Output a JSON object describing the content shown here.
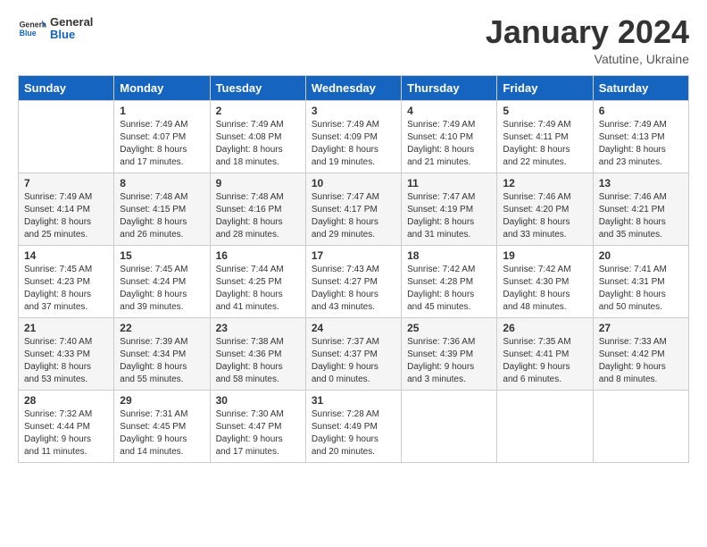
{
  "header": {
    "logo_general": "General",
    "logo_blue": "Blue",
    "month_title": "January 2024",
    "location": "Vatutine, Ukraine"
  },
  "days_of_week": [
    "Sunday",
    "Monday",
    "Tuesday",
    "Wednesday",
    "Thursday",
    "Friday",
    "Saturday"
  ],
  "weeks": [
    [
      {
        "day": "",
        "sunrise": "",
        "sunset": "",
        "daylight": ""
      },
      {
        "day": "1",
        "sunrise": "7:49 AM",
        "sunset": "4:07 PM",
        "daylight": "8 hours and 17 minutes."
      },
      {
        "day": "2",
        "sunrise": "7:49 AM",
        "sunset": "4:08 PM",
        "daylight": "8 hours and 18 minutes."
      },
      {
        "day": "3",
        "sunrise": "7:49 AM",
        "sunset": "4:09 PM",
        "daylight": "8 hours and 19 minutes."
      },
      {
        "day": "4",
        "sunrise": "7:49 AM",
        "sunset": "4:10 PM",
        "daylight": "8 hours and 21 minutes."
      },
      {
        "day": "5",
        "sunrise": "7:49 AM",
        "sunset": "4:11 PM",
        "daylight": "8 hours and 22 minutes."
      },
      {
        "day": "6",
        "sunrise": "7:49 AM",
        "sunset": "4:13 PM",
        "daylight": "8 hours and 23 minutes."
      }
    ],
    [
      {
        "day": "7",
        "sunrise": "7:49 AM",
        "sunset": "4:14 PM",
        "daylight": "8 hours and 25 minutes."
      },
      {
        "day": "8",
        "sunrise": "7:48 AM",
        "sunset": "4:15 PM",
        "daylight": "8 hours and 26 minutes."
      },
      {
        "day": "9",
        "sunrise": "7:48 AM",
        "sunset": "4:16 PM",
        "daylight": "8 hours and 28 minutes."
      },
      {
        "day": "10",
        "sunrise": "7:47 AM",
        "sunset": "4:17 PM",
        "daylight": "8 hours and 29 minutes."
      },
      {
        "day": "11",
        "sunrise": "7:47 AM",
        "sunset": "4:19 PM",
        "daylight": "8 hours and 31 minutes."
      },
      {
        "day": "12",
        "sunrise": "7:46 AM",
        "sunset": "4:20 PM",
        "daylight": "8 hours and 33 minutes."
      },
      {
        "day": "13",
        "sunrise": "7:46 AM",
        "sunset": "4:21 PM",
        "daylight": "8 hours and 35 minutes."
      }
    ],
    [
      {
        "day": "14",
        "sunrise": "7:45 AM",
        "sunset": "4:23 PM",
        "daylight": "8 hours and 37 minutes."
      },
      {
        "day": "15",
        "sunrise": "7:45 AM",
        "sunset": "4:24 PM",
        "daylight": "8 hours and 39 minutes."
      },
      {
        "day": "16",
        "sunrise": "7:44 AM",
        "sunset": "4:25 PM",
        "daylight": "8 hours and 41 minutes."
      },
      {
        "day": "17",
        "sunrise": "7:43 AM",
        "sunset": "4:27 PM",
        "daylight": "8 hours and 43 minutes."
      },
      {
        "day": "18",
        "sunrise": "7:42 AM",
        "sunset": "4:28 PM",
        "daylight": "8 hours and 45 minutes."
      },
      {
        "day": "19",
        "sunrise": "7:42 AM",
        "sunset": "4:30 PM",
        "daylight": "8 hours and 48 minutes."
      },
      {
        "day": "20",
        "sunrise": "7:41 AM",
        "sunset": "4:31 PM",
        "daylight": "8 hours and 50 minutes."
      }
    ],
    [
      {
        "day": "21",
        "sunrise": "7:40 AM",
        "sunset": "4:33 PM",
        "daylight": "8 hours and 53 minutes."
      },
      {
        "day": "22",
        "sunrise": "7:39 AM",
        "sunset": "4:34 PM",
        "daylight": "8 hours and 55 minutes."
      },
      {
        "day": "23",
        "sunrise": "7:38 AM",
        "sunset": "4:36 PM",
        "daylight": "8 hours and 58 minutes."
      },
      {
        "day": "24",
        "sunrise": "7:37 AM",
        "sunset": "4:37 PM",
        "daylight": "9 hours and 0 minutes."
      },
      {
        "day": "25",
        "sunrise": "7:36 AM",
        "sunset": "4:39 PM",
        "daylight": "9 hours and 3 minutes."
      },
      {
        "day": "26",
        "sunrise": "7:35 AM",
        "sunset": "4:41 PM",
        "daylight": "9 hours and 6 minutes."
      },
      {
        "day": "27",
        "sunrise": "7:33 AM",
        "sunset": "4:42 PM",
        "daylight": "9 hours and 8 minutes."
      }
    ],
    [
      {
        "day": "28",
        "sunrise": "7:32 AM",
        "sunset": "4:44 PM",
        "daylight": "9 hours and 11 minutes."
      },
      {
        "day": "29",
        "sunrise": "7:31 AM",
        "sunset": "4:45 PM",
        "daylight": "9 hours and 14 minutes."
      },
      {
        "day": "30",
        "sunrise": "7:30 AM",
        "sunset": "4:47 PM",
        "daylight": "9 hours and 17 minutes."
      },
      {
        "day": "31",
        "sunrise": "7:28 AM",
        "sunset": "4:49 PM",
        "daylight": "9 hours and 20 minutes."
      },
      {
        "day": "",
        "sunrise": "",
        "sunset": "",
        "daylight": ""
      },
      {
        "day": "",
        "sunrise": "",
        "sunset": "",
        "daylight": ""
      },
      {
        "day": "",
        "sunrise": "",
        "sunset": "",
        "daylight": ""
      }
    ]
  ]
}
